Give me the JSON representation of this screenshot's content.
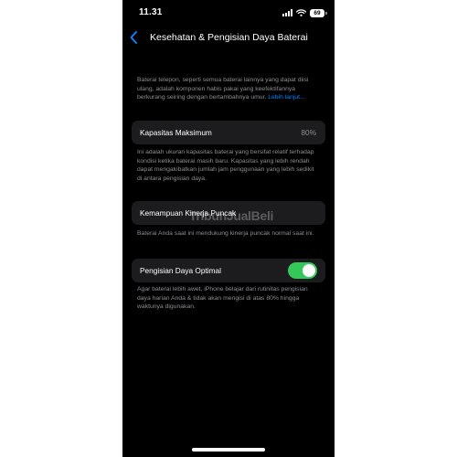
{
  "status_bar": {
    "time": "11.31",
    "battery": "69"
  },
  "nav": {
    "title": "Kesehatan & Pengisian Daya Baterai",
    "back_icon": "chevron-left-icon"
  },
  "intro": {
    "text": "Baterai telepon, seperti semua baterai lainnya yang dapat diisi ulang, adalah komponen habis pakai yang keefektifannya berkurang seiring dengan bertambahnya umur.",
    "link": "Lebih lanjut..."
  },
  "max_capacity": {
    "label": "Kapasitas Maksimum",
    "value": "80%",
    "description": "Ini adalah ukuran kapasitas baterai yang bersifat relatif terhadap kondisi ketika baterai masih baru. Kapasitas yang lebih rendah dapat mengakibatkan jumlah jam penggunaan yang lebih sedikit di antara pengisian daya."
  },
  "peak_performance": {
    "label": "Kemampuan Kinerja Puncak",
    "description": "Baterai Anda saat ini mendukung kinerja puncak normal saat ini."
  },
  "optimized_charging": {
    "label": "Pengisian Daya Optimal",
    "enabled": true,
    "description": "Agar baterai lebih awet, iPhone belajar dari rutinitas pengisian daya harian Anda & tidak akan mengisi di atas 80% hingga waktunya digunakan."
  },
  "watermark": "TribunJualBeli",
  "colors": {
    "background": "#000000",
    "cell": "#1c1c1e",
    "accent": "#0a84ff",
    "toggle_on": "#34c759",
    "secondary_text": "#8e8e93"
  }
}
